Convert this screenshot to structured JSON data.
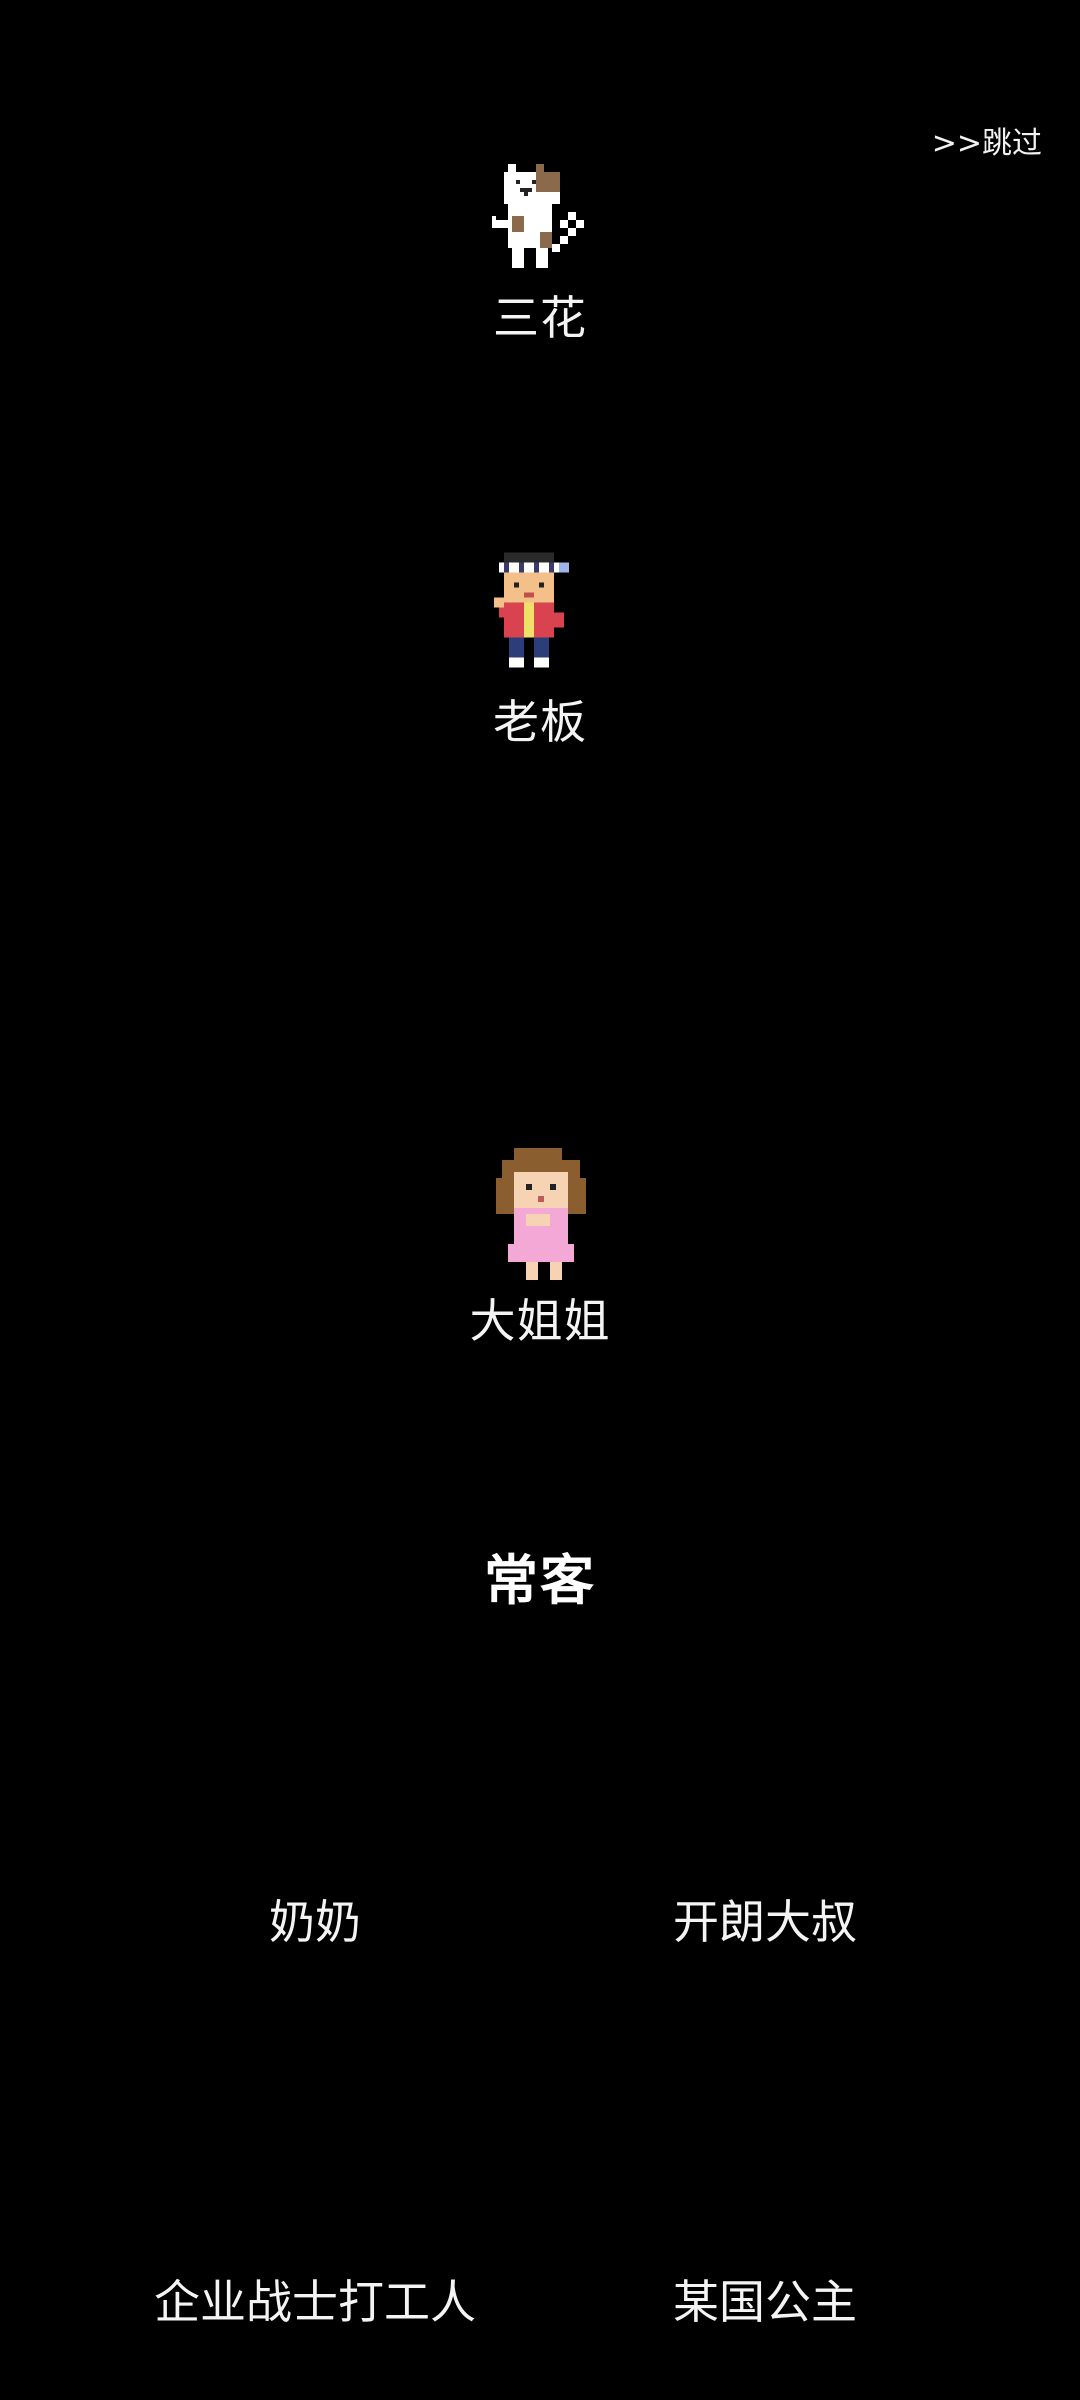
{
  "skip_label": ">>跳过",
  "characters": [
    {
      "name": "三花",
      "icon": "calico-cat-icon"
    },
    {
      "name": "老板",
      "icon": "boss-icon"
    },
    {
      "name": "大姐姐",
      "icon": "big-sister-icon"
    }
  ],
  "section": {
    "title": "常客"
  },
  "regulars": [
    {
      "name": "奶奶"
    },
    {
      "name": "开朗大叔"
    },
    {
      "name": "企业战士打工人"
    },
    {
      "name": "某国公主"
    }
  ],
  "colors": {
    "background": "#000000",
    "text": "#ffffff"
  }
}
